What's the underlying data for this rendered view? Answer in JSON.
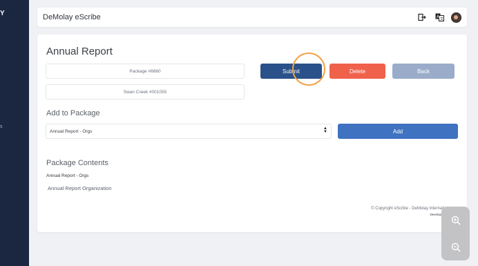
{
  "sidebar": {
    "logo_fragment": "Y",
    "label_fragment": "s"
  },
  "topbar": {
    "title": "DeMolay eScribe",
    "icons": [
      "logout-icon",
      "translate-icon",
      "avatar"
    ]
  },
  "page": {
    "title": "Annual Report",
    "package_field": "Package #6660",
    "chapter_field": "Swan Creek #001055"
  },
  "actions": {
    "submit_label": "Submit",
    "delete_label": "Delete",
    "back_label": "Back"
  },
  "add_to_package": {
    "heading": "Add to Package",
    "selected_option": "Annual Report - Orgs",
    "add_label": "Add"
  },
  "package_contents": {
    "heading": "Package Contents",
    "group_label": "Annual Report - Orgs",
    "items": [
      "Annual Report Organization"
    ]
  },
  "footer": {
    "copyright": "© Copyright eScribe - DeMolay Internation",
    "developed_by": "Developed by"
  },
  "zoom": {
    "icons": [
      "zoom-in-icon",
      "zoom-out-icon"
    ]
  },
  "colors": {
    "sidebar": "#1b2641",
    "submit": "#2a5189",
    "delete": "#f0614b",
    "back": "#9aacc9",
    "add": "#3f72c0",
    "highlight": "#f3a24a"
  }
}
